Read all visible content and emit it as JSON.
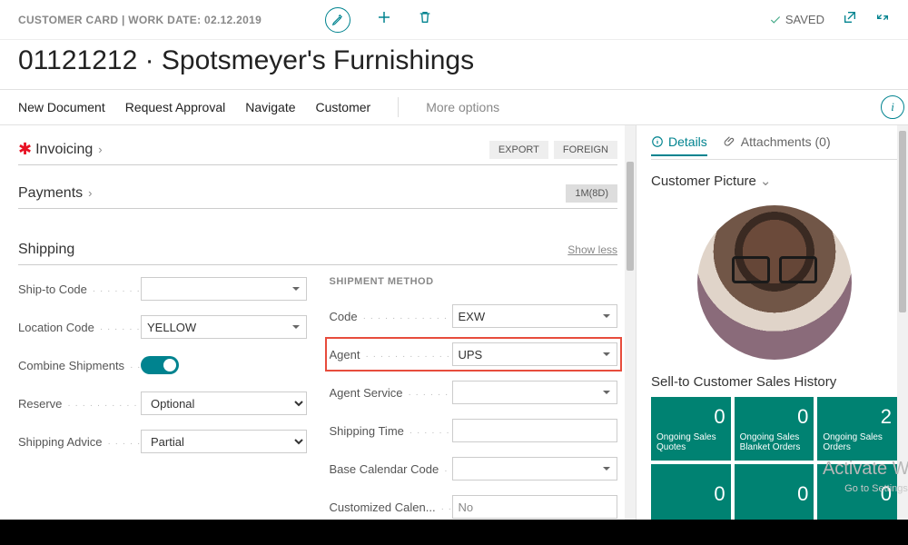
{
  "breadcrumb": "CUSTOMER CARD | WORK DATE: 02.12.2019",
  "saved_label": "SAVED",
  "page_title": "01121212 · Spotsmeyer's Furnishings",
  "actions": {
    "new_document": "New Document",
    "request_approval": "Request Approval",
    "navigate": "Navigate",
    "customer": "Customer",
    "more_options": "More options"
  },
  "fasttabs": {
    "invoicing": {
      "title": "Invoicing",
      "badges": [
        "EXPORT",
        "FOREIGN"
      ]
    },
    "payments": {
      "title": "Payments",
      "summary": "1M(8D)"
    },
    "shipping": {
      "title": "Shipping",
      "show_less": "Show less"
    }
  },
  "shipping": {
    "left": {
      "ship_to_code_label": "Ship-to Code",
      "ship_to_code": "",
      "location_code_label": "Location Code",
      "location_code": "YELLOW",
      "combine_shipments_label": "Combine Shipments",
      "combine_shipments": true,
      "reserve_label": "Reserve",
      "reserve": "Optional",
      "shipping_advice_label": "Shipping Advice",
      "shipping_advice": "Partial"
    },
    "right": {
      "group_title": "SHIPMENT METHOD",
      "code_label": "Code",
      "code": "EXW",
      "agent_label": "Agent",
      "agent": "UPS",
      "agent_service_label": "Agent Service",
      "agent_service": "",
      "shipping_time_label": "Shipping Time",
      "shipping_time": "",
      "base_calendar_label": "Base Calendar Code",
      "base_calendar": "",
      "customized_calendar_label": "Customized Calen...",
      "customized_calendar": "No"
    }
  },
  "side": {
    "tabs": {
      "details": "Details",
      "attachments": "Attachments (0)"
    },
    "picture_title": "Customer Picture",
    "history_title": "Sell-to Customer Sales History",
    "tiles": [
      {
        "num": "0",
        "cap": "Ongoing Sales Quotes"
      },
      {
        "num": "0",
        "cap": "Ongoing Sales Blanket Orders"
      },
      {
        "num": "2",
        "cap": "Ongoing Sales Orders"
      },
      {
        "num": "0",
        "cap": ""
      },
      {
        "num": "0",
        "cap": ""
      },
      {
        "num": "0",
        "cap": ""
      }
    ]
  },
  "watermark": {
    "line1": "Activate Wi",
    "line2": "Go to Settings t"
  }
}
